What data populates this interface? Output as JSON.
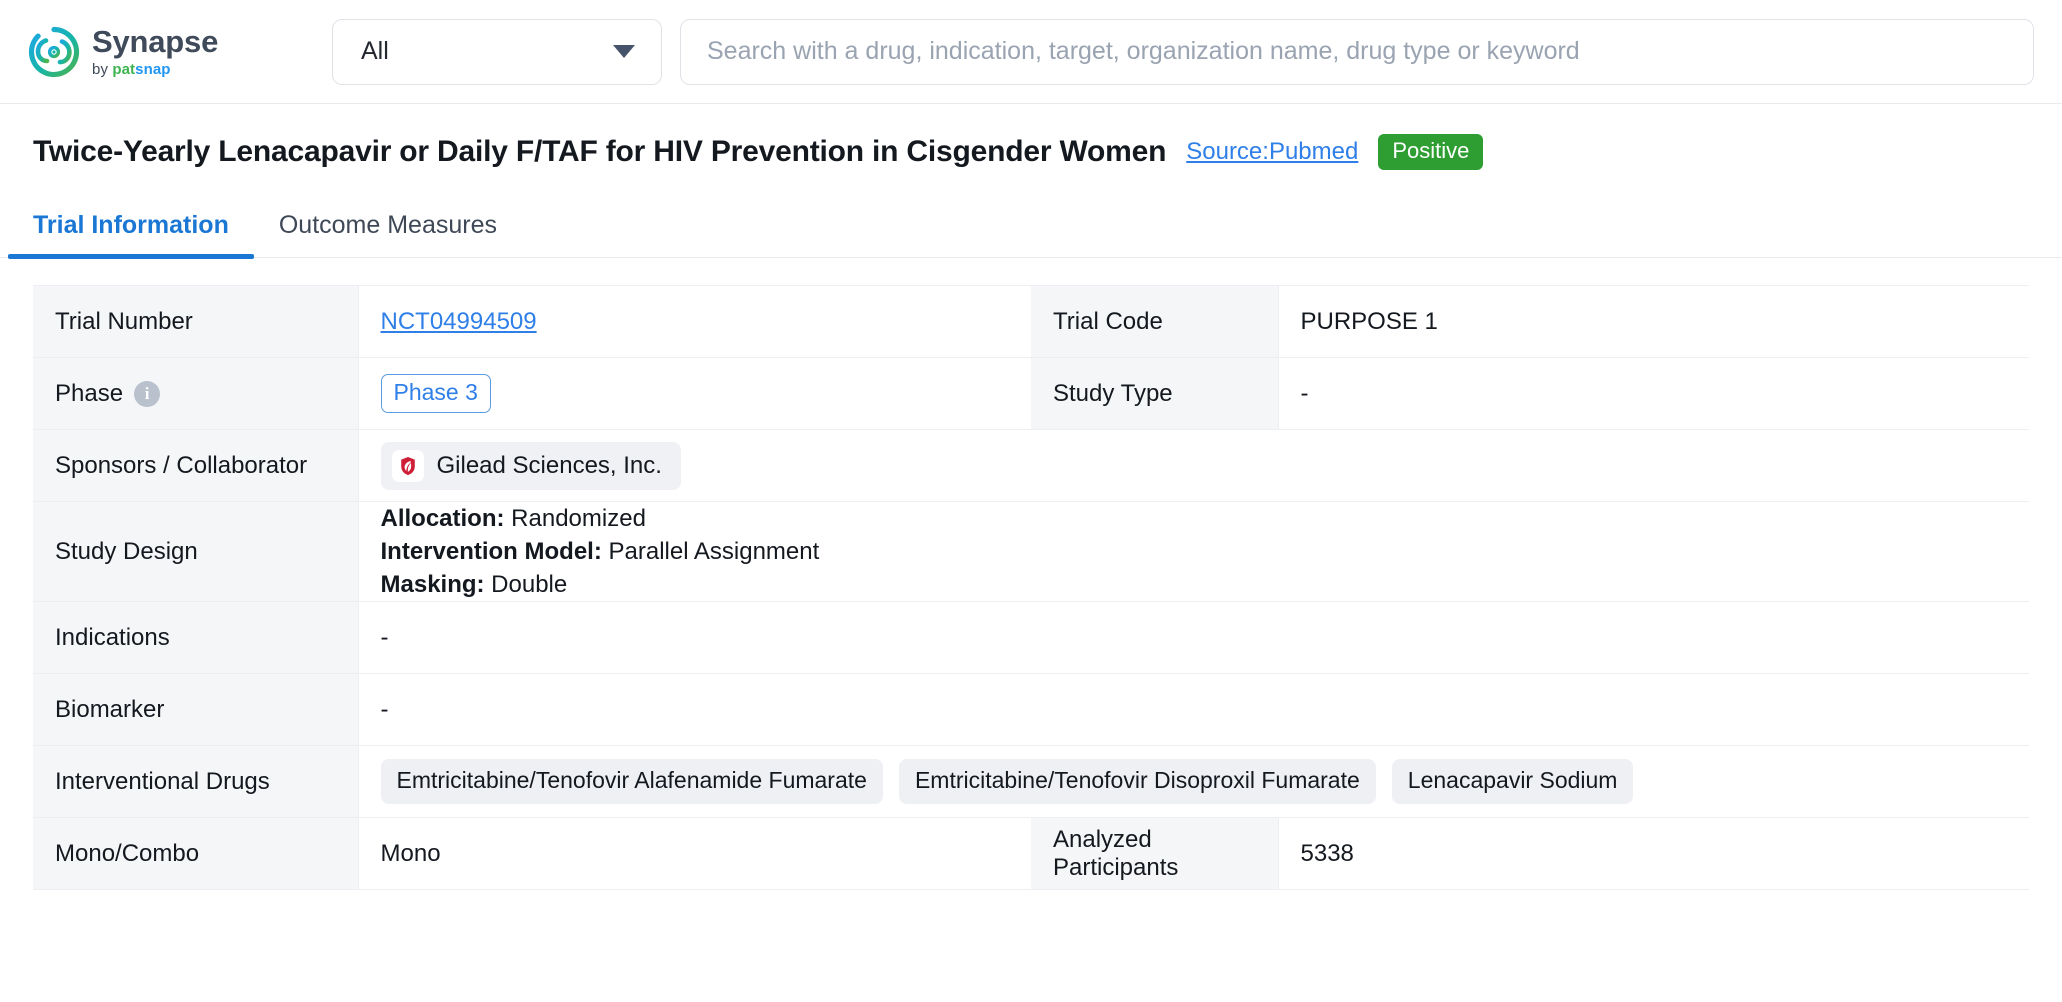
{
  "header": {
    "brand": {
      "name": "Synapse",
      "by": "by ",
      "pat": "pat",
      "snap": "snap",
      "logo_icon": "synapse-ring-logo"
    },
    "scope": {
      "selected": "All",
      "caret_icon": "chevron-down-icon"
    },
    "search": {
      "value": "",
      "placeholder": "Search with a drug, indication, target, organization name, drug type or keyword"
    }
  },
  "title_bar": {
    "title": "Twice-Yearly Lenacapavir or Daily F/TAF for HIV Prevention in Cisgender Women",
    "source": "Source:Pubmed",
    "status": "Positive",
    "status_color": "#2e9e32"
  },
  "tabs": [
    {
      "label": "Trial Information",
      "active": true
    },
    {
      "label": "Outcome Measures",
      "active": false
    }
  ],
  "table": {
    "trial_number": {
      "label": "Trial Number",
      "value": "NCT04994509"
    },
    "trial_code": {
      "label": "Trial Code",
      "value": "PURPOSE 1"
    },
    "phase": {
      "label": "Phase",
      "info_icon": "info-icon",
      "value": "Phase 3"
    },
    "study_type": {
      "label": "Study Type",
      "value": "-"
    },
    "sponsors": {
      "label": "Sponsors / Collaborator",
      "org": "Gilead Sciences, Inc.",
      "org_logo_icon": "gilead-shield-icon"
    },
    "study_design": {
      "label": "Study Design",
      "lines": [
        {
          "key": "Allocation:",
          "value": " Randomized"
        },
        {
          "key": "Intervention Model:",
          "value": " Parallel Assignment"
        },
        {
          "key": "Masking:",
          "value": " Double"
        }
      ]
    },
    "indications": {
      "label": "Indications",
      "value": "-"
    },
    "biomarker": {
      "label": "Biomarker",
      "value": "-"
    },
    "interventional_drugs": {
      "label": "Interventional Drugs",
      "tags": [
        "Emtricitabine/Tenofovir Alafenamide Fumarate",
        "Emtricitabine/Tenofovir Disoproxil Fumarate",
        "Lenacapavir Sodium"
      ]
    },
    "mono_combo": {
      "label": "Mono/Combo",
      "value": "Mono"
    },
    "analyzed_participants": {
      "label": "Analyzed Participants",
      "value": "5338"
    }
  }
}
